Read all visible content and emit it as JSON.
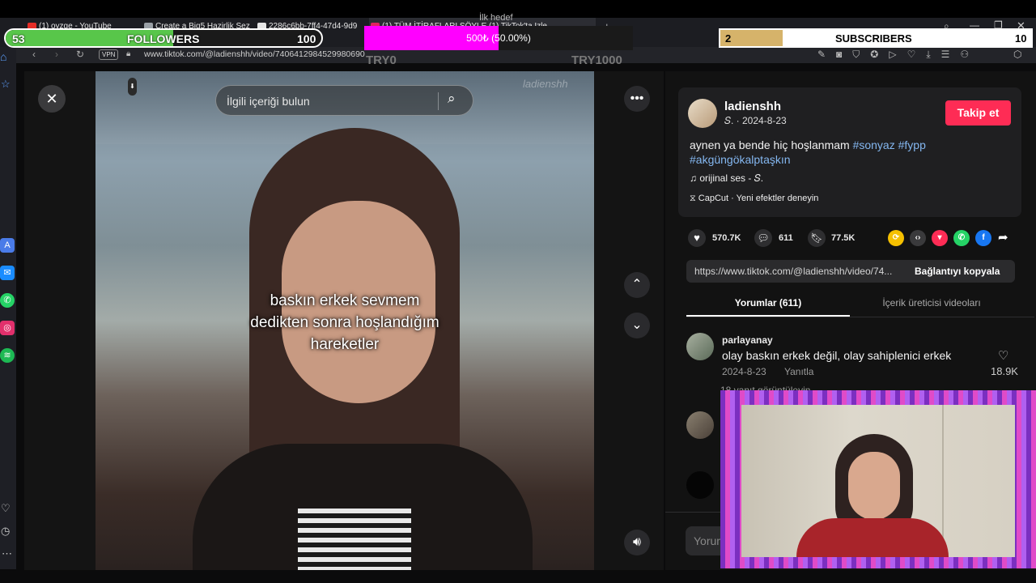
{
  "browser": {
    "tabs": [
      {
        "title": "(1) oyzge - YouTube",
        "color": "#e52d27"
      },
      {
        "title": "Create a Big5 Hazirlik Sez",
        "color": "#9aa0a6"
      },
      {
        "title": "2286c6bb-7ff4-47d4-9d9",
        "color": "#e6e6e6"
      },
      {
        "title": "(1) TÜM İTİRAFLARI SÖYLE (1) TikTok'ta Izle",
        "color": "#e0245e"
      }
    ],
    "url": "www.tiktok.com/@ladienshh/video/7406412984529980690",
    "vpn_label": "VPN"
  },
  "overlay": {
    "followers": {
      "current": "53",
      "label": "FOLLOWERS",
      "goal": "100",
      "progress": 0.53
    },
    "goal_widget": {
      "title": "İlk hedef",
      "text": "500₺ (50.00%)",
      "left_label": "TRY0",
      "right_label": "TRY1000",
      "progress": 0.5
    },
    "subscribers": {
      "current": "2",
      "label": "SUBSCRIBERS",
      "goal": "10",
      "progress": 0.2
    }
  },
  "video": {
    "search_placeholder": "İlgili içeriği bulun",
    "watermark": "ladienshh",
    "caption": [
      "baskın erkek sevmem",
      "dedikten sonra hoşlandığım",
      "hareketler"
    ]
  },
  "post": {
    "username": "ladienshh",
    "subline": "𝑆. · 2024-8-23",
    "follow_label": "Takip et",
    "description": "aynen ya bende hiç hoşlanmam",
    "hashtags": [
      "#sonyaz",
      "#fypp",
      "#akgüngökalptaşkın"
    ],
    "sound": "orijinal ses - 𝑆.",
    "capcut": "CapCut · Yeni efektler deneyin",
    "likes": "570.7K",
    "comments": "611",
    "saves": "77.5K",
    "link": "https://www.tiktok.com/@ladienshh/video/74...",
    "copy_label": "Bağlantıyı kopyala",
    "tab_comments": "Yorumlar (611)",
    "tab_creator": "İçerik üreticisi videoları",
    "comment_placeholder": "Yorum"
  },
  "comments": [
    {
      "user": "parlayanay",
      "text": "olay baskın erkek değil, olay sahiplenici erkek",
      "date": "2024-8-23",
      "reply": "Yanıtla",
      "likes": "18.9K",
      "replies": "18 yanıt görüntüleyin"
    }
  ],
  "colors": {
    "accent": "#fe2c55",
    "followers": "#58c64a",
    "goal": "#ff00ff",
    "subscribers": "#d6b36a",
    "frame": "#a040e8"
  }
}
